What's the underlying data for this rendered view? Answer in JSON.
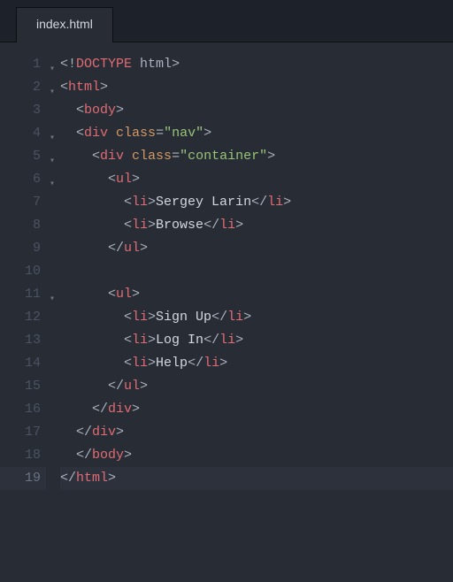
{
  "tab": {
    "label": "index.html"
  },
  "gutter": {
    "lines": [
      "1",
      "2",
      "3",
      "4",
      "5",
      "6",
      "7",
      "8",
      "9",
      "10",
      "11",
      "12",
      "13",
      "14",
      "15",
      "16",
      "17",
      "18",
      "19"
    ],
    "foldable": [
      1,
      2,
      4,
      5,
      6,
      11
    ],
    "active": 19
  },
  "code": {
    "lines": [
      {
        "indent": 1,
        "tokens": [
          {
            "t": "bracket",
            "v": "<!"
          },
          {
            "t": "doctype-kw",
            "v": "DOCTYPE"
          },
          {
            "t": "doctype",
            "v": " html"
          },
          {
            "t": "bracket",
            "v": ">"
          }
        ]
      },
      {
        "indent": 1,
        "tokens": [
          {
            "t": "bracket",
            "v": "<"
          },
          {
            "t": "tagname",
            "v": "html"
          },
          {
            "t": "bracket",
            "v": ">"
          }
        ]
      },
      {
        "indent": 2,
        "tokens": [
          {
            "t": "bracket",
            "v": "<"
          },
          {
            "t": "tagname",
            "v": "body"
          },
          {
            "t": "bracket",
            "v": ">"
          }
        ]
      },
      {
        "indent": 2,
        "tokens": [
          {
            "t": "bracket",
            "v": "<"
          },
          {
            "t": "tagname",
            "v": "div"
          },
          {
            "t": "punct",
            "v": " "
          },
          {
            "t": "attr",
            "v": "class"
          },
          {
            "t": "eq",
            "v": "="
          },
          {
            "t": "string",
            "v": "\"nav\""
          },
          {
            "t": "bracket",
            "v": ">"
          }
        ]
      },
      {
        "indent": 3,
        "tokens": [
          {
            "t": "bracket",
            "v": "<"
          },
          {
            "t": "tagname",
            "v": "div"
          },
          {
            "t": "punct",
            "v": " "
          },
          {
            "t": "attr",
            "v": "class"
          },
          {
            "t": "eq",
            "v": "="
          },
          {
            "t": "string",
            "v": "\"container\""
          },
          {
            "t": "bracket",
            "v": ">"
          }
        ]
      },
      {
        "indent": 4,
        "tokens": [
          {
            "t": "bracket",
            "v": "<"
          },
          {
            "t": "tagname",
            "v": "ul"
          },
          {
            "t": "bracket",
            "v": ">"
          }
        ]
      },
      {
        "indent": 5,
        "tokens": [
          {
            "t": "bracket",
            "v": "<"
          },
          {
            "t": "tagname",
            "v": "li"
          },
          {
            "t": "bracket",
            "v": ">"
          },
          {
            "t": "text",
            "v": "Sergey Larin"
          },
          {
            "t": "bracket",
            "v": "</"
          },
          {
            "t": "tagname",
            "v": "li"
          },
          {
            "t": "bracket",
            "v": ">"
          }
        ]
      },
      {
        "indent": 5,
        "tokens": [
          {
            "t": "bracket",
            "v": "<"
          },
          {
            "t": "tagname",
            "v": "li"
          },
          {
            "t": "bracket",
            "v": ">"
          },
          {
            "t": "text",
            "v": "Browse"
          },
          {
            "t": "bracket",
            "v": "</"
          },
          {
            "t": "tagname",
            "v": "li"
          },
          {
            "t": "bracket",
            "v": ">"
          }
        ]
      },
      {
        "indent": 4,
        "tokens": [
          {
            "t": "bracket",
            "v": "</"
          },
          {
            "t": "tagname",
            "v": "ul"
          },
          {
            "t": "bracket",
            "v": ">"
          }
        ]
      },
      {
        "indent": 1,
        "tokens": []
      },
      {
        "indent": 4,
        "tokens": [
          {
            "t": "bracket",
            "v": "<"
          },
          {
            "t": "tagname",
            "v": "ul"
          },
          {
            "t": "bracket",
            "v": ">"
          }
        ]
      },
      {
        "indent": 5,
        "tokens": [
          {
            "t": "bracket",
            "v": "<"
          },
          {
            "t": "tagname",
            "v": "li"
          },
          {
            "t": "bracket",
            "v": ">"
          },
          {
            "t": "text",
            "v": "Sign Up"
          },
          {
            "t": "bracket",
            "v": "</"
          },
          {
            "t": "tagname",
            "v": "li"
          },
          {
            "t": "bracket",
            "v": ">"
          }
        ]
      },
      {
        "indent": 5,
        "tokens": [
          {
            "t": "bracket",
            "v": "<"
          },
          {
            "t": "tagname",
            "v": "li"
          },
          {
            "t": "bracket",
            "v": ">"
          },
          {
            "t": "text",
            "v": "Log In"
          },
          {
            "t": "bracket",
            "v": "</"
          },
          {
            "t": "tagname",
            "v": "li"
          },
          {
            "t": "bracket",
            "v": ">"
          }
        ]
      },
      {
        "indent": 5,
        "tokens": [
          {
            "t": "bracket",
            "v": "<"
          },
          {
            "t": "tagname",
            "v": "li"
          },
          {
            "t": "bracket",
            "v": ">"
          },
          {
            "t": "text",
            "v": "Help"
          },
          {
            "t": "bracket",
            "v": "</"
          },
          {
            "t": "tagname",
            "v": "li"
          },
          {
            "t": "bracket",
            "v": ">"
          }
        ]
      },
      {
        "indent": 4,
        "tokens": [
          {
            "t": "bracket",
            "v": "</"
          },
          {
            "t": "tagname",
            "v": "ul"
          },
          {
            "t": "bracket",
            "v": ">"
          }
        ]
      },
      {
        "indent": 3,
        "tokens": [
          {
            "t": "bracket",
            "v": "</"
          },
          {
            "t": "tagname",
            "v": "div"
          },
          {
            "t": "bracket",
            "v": ">"
          }
        ]
      },
      {
        "indent": 2,
        "tokens": [
          {
            "t": "bracket",
            "v": "</"
          },
          {
            "t": "tagname",
            "v": "div"
          },
          {
            "t": "bracket",
            "v": ">"
          }
        ]
      },
      {
        "indent": 2,
        "tokens": [
          {
            "t": "bracket",
            "v": "</"
          },
          {
            "t": "tagname",
            "v": "body"
          },
          {
            "t": "bracket",
            "v": ">"
          }
        ]
      },
      {
        "indent": 1,
        "tokens": [
          {
            "t": "bracket",
            "v": "</"
          },
          {
            "t": "tagname",
            "v": "html"
          },
          {
            "t": "bracket",
            "v": ">"
          }
        ]
      }
    ]
  }
}
